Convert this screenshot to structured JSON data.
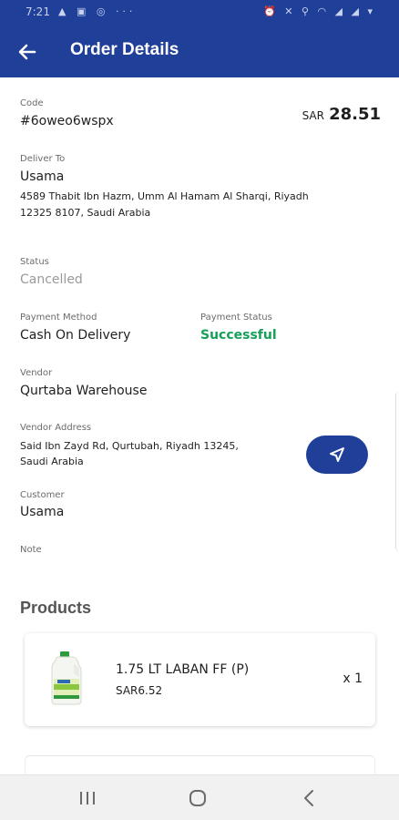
{
  "status_bar": {
    "time": "7:21",
    "left_icons": "▲ ▣ ◎ ···",
    "right_icons": "⏰ ✕ ⚲ ◠ ◢ ◢ ▾"
  },
  "header": {
    "title": "Order Details",
    "back_icon": "arrow-left-icon"
  },
  "order": {
    "code_label": "Code",
    "code": "#6oweo6wspx",
    "currency": "SAR",
    "total": "28.51",
    "deliver_to_label": "Deliver To",
    "deliver_name": "Usama",
    "deliver_address_line1": "4589 Thabit Ibn Hazm, Umm Al Hamam Al Sharqi, Riyadh",
    "deliver_address_line2": "12325 8107, Saudi Arabia",
    "status_label": "Status",
    "status": "Cancelled",
    "payment_method_label": "Payment Method",
    "payment_method": "Cash On Delivery",
    "payment_status_label": "Payment Status",
    "payment_status": "Successful",
    "vendor_label": "Vendor",
    "vendor": "Qurtaba Warehouse",
    "vendor_address_label": "Vendor Address",
    "vendor_address_line1": "Said Ibn Zayd Rd, Qurtubah, Riyadh 13245,",
    "vendor_address_line2": "Saudi Arabia",
    "customer_label": "Customer",
    "customer": "Usama",
    "note_label": "Note",
    "navigate_icon": "navigation-arrow-icon"
  },
  "products": {
    "title": "Products",
    "items": [
      {
        "name": "1.75 LT LABAN FF (P)",
        "price": "SAR6.52",
        "quantity": "x 1"
      }
    ]
  },
  "colors": {
    "primary": "#1f3f98",
    "success": "#15a058",
    "muted": "#9a9a9a"
  },
  "system_nav": {
    "recents_icon": "recents-icon",
    "home_icon": "home-icon",
    "back_icon": "back-chevron-icon"
  }
}
